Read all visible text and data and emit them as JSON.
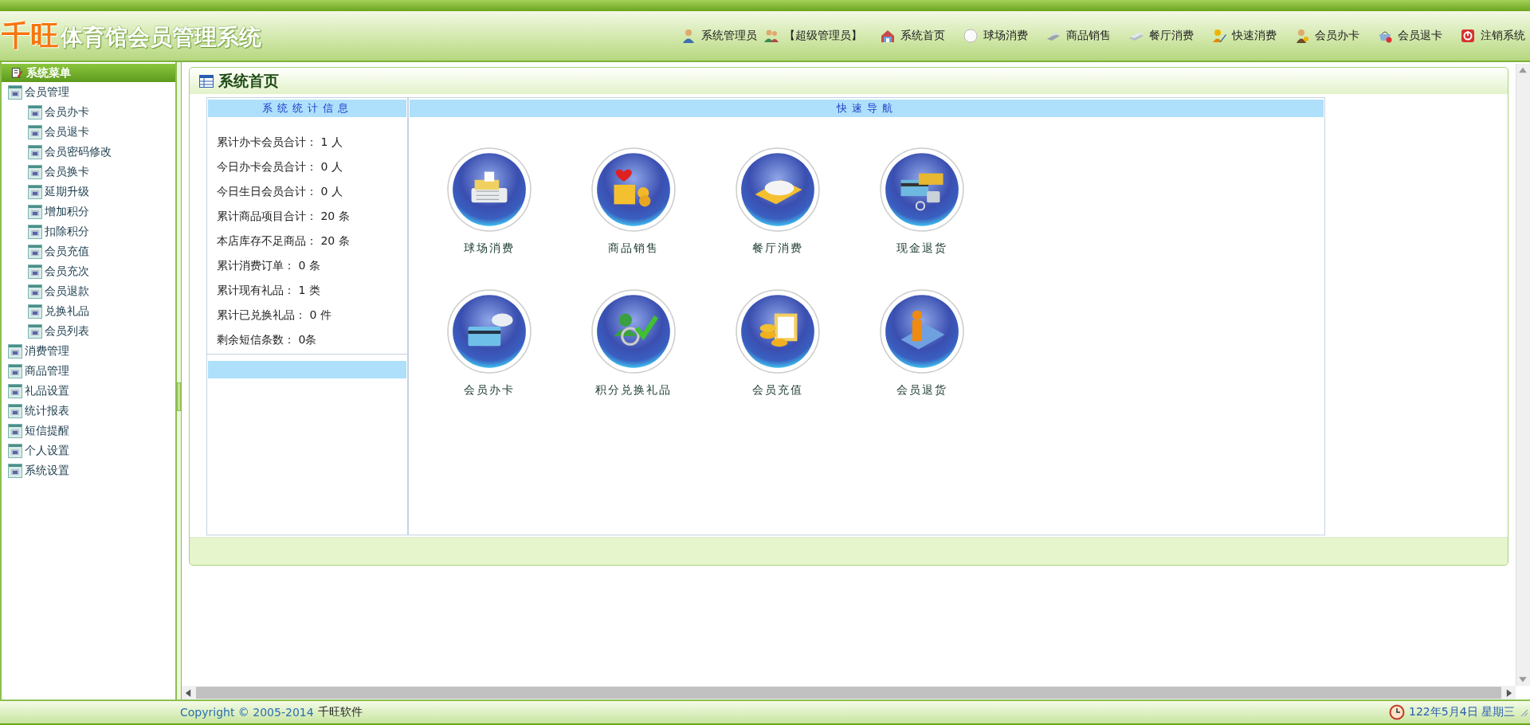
{
  "header": {
    "brand": "千旺",
    "title": "体育馆会员管理系统",
    "user": "系统管理员",
    "role": "【超级管理员】",
    "nav": [
      {
        "label": "系统首页"
      },
      {
        "label": "球场消费"
      },
      {
        "label": "商品销售"
      },
      {
        "label": "餐厅消费"
      },
      {
        "label": "快速消费"
      },
      {
        "label": "会员办卡"
      },
      {
        "label": "会员退卡"
      },
      {
        "label": "注销系统"
      }
    ]
  },
  "sidebar": {
    "title": "系统菜单",
    "items": [
      {
        "label": "会员管理",
        "children": [
          {
            "label": "会员办卡"
          },
          {
            "label": "会员退卡"
          },
          {
            "label": "会员密码修改"
          },
          {
            "label": "会员换卡"
          },
          {
            "label": "延期升级"
          },
          {
            "label": "增加积分"
          },
          {
            "label": "扣除积分"
          },
          {
            "label": "会员充值"
          },
          {
            "label": "会员充次"
          },
          {
            "label": "会员退款"
          },
          {
            "label": "兑换礼品"
          },
          {
            "label": "会员列表"
          }
        ]
      },
      {
        "label": "消费管理"
      },
      {
        "label": "商品管理"
      },
      {
        "label": "礼品设置"
      },
      {
        "label": "统计报表"
      },
      {
        "label": "短信提醒"
      },
      {
        "label": "个人设置"
      },
      {
        "label": "系统设置"
      }
    ]
  },
  "main": {
    "title": "系统首页",
    "stats": {
      "title": "系统统计信息",
      "rows": [
        "累计办卡会员合计： 1 人",
        "今日办卡会员合计： 0 人",
        "今日生日会员合计： 0 人",
        "累计商品项目合计： 20 条",
        "本店库存不足商品： 20 条",
        "累计消费订单： 0 条",
        "累计现有礼品： 1 类",
        "累计已兑换礼品： 0 件",
        "剩余短信条数： 0条"
      ]
    },
    "quick_nav": {
      "title": "快速导航",
      "items": [
        {
          "label": "球场消费"
        },
        {
          "label": "商品销售"
        },
        {
          "label": "餐厅消费"
        },
        {
          "label": "现金退货"
        },
        {
          "label": "会员办卡"
        },
        {
          "label": "积分兑换礼品"
        },
        {
          "label": "会员充值"
        },
        {
          "label": "会员退货"
        }
      ]
    }
  },
  "status_bar": {
    "copyright": "Copyright © 2005-2014",
    "company": "千旺软件",
    "date": "122年5月4日 星期三"
  }
}
